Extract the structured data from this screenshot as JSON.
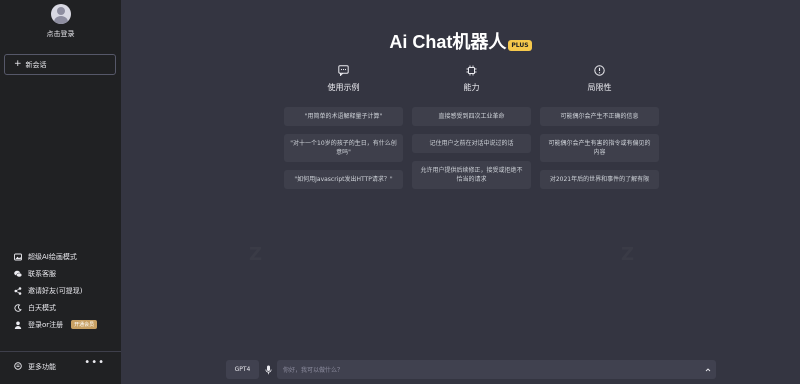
{
  "sidebar": {
    "login_text": "点击登录",
    "new_chat_label": "新会话",
    "menu": [
      {
        "icon": "image-icon",
        "label": "超级AI绘画模式"
      },
      {
        "icon": "wechat-icon",
        "label": "联系客服"
      },
      {
        "icon": "share-icon",
        "label": "邀请好友(可提现)"
      },
      {
        "icon": "moon-icon",
        "label": "白天模式"
      },
      {
        "icon": "user-icon",
        "label": "登录or注册",
        "badge": "开通会员"
      }
    ],
    "more_label": "更多功能",
    "more_dots": "•••"
  },
  "main": {
    "title": "Ai Chat机器人",
    "title_badge": "PLUS",
    "columns": [
      {
        "icon": "chat-bubble-icon",
        "title": "使用示例",
        "cards": [
          "\"用简单的术语解释量子计算\"",
          "\"对十一个10岁的孩子的生日，有什么创意吗\"",
          "\"如何用Javascript发出HTTP请求？\""
        ]
      },
      {
        "icon": "chip-icon",
        "title": "能力",
        "cards": [
          "直接感受到四次工业革命",
          "记住用户之前在对话中说过的话",
          "允许用户提供后续修正，接受或拒绝不恰当的请求"
        ]
      },
      {
        "icon": "warning-icon",
        "title": "局限性",
        "cards": [
          "可能偶尔会产生不正确的信息",
          "可能偶尔会产生有害的指令或有偏见的内容",
          "对2021年后的世界和事件的了解有限"
        ]
      }
    ]
  },
  "input": {
    "model_label": "GPT4",
    "placeholder": "你好，我可以做什么？"
  },
  "colors": {
    "sidebar_bg": "#202123",
    "main_bg": "#343541",
    "card_bg": "#3e3f4b",
    "badge_yellow": "#f5c84c",
    "vip_gold": "#c8a063"
  }
}
